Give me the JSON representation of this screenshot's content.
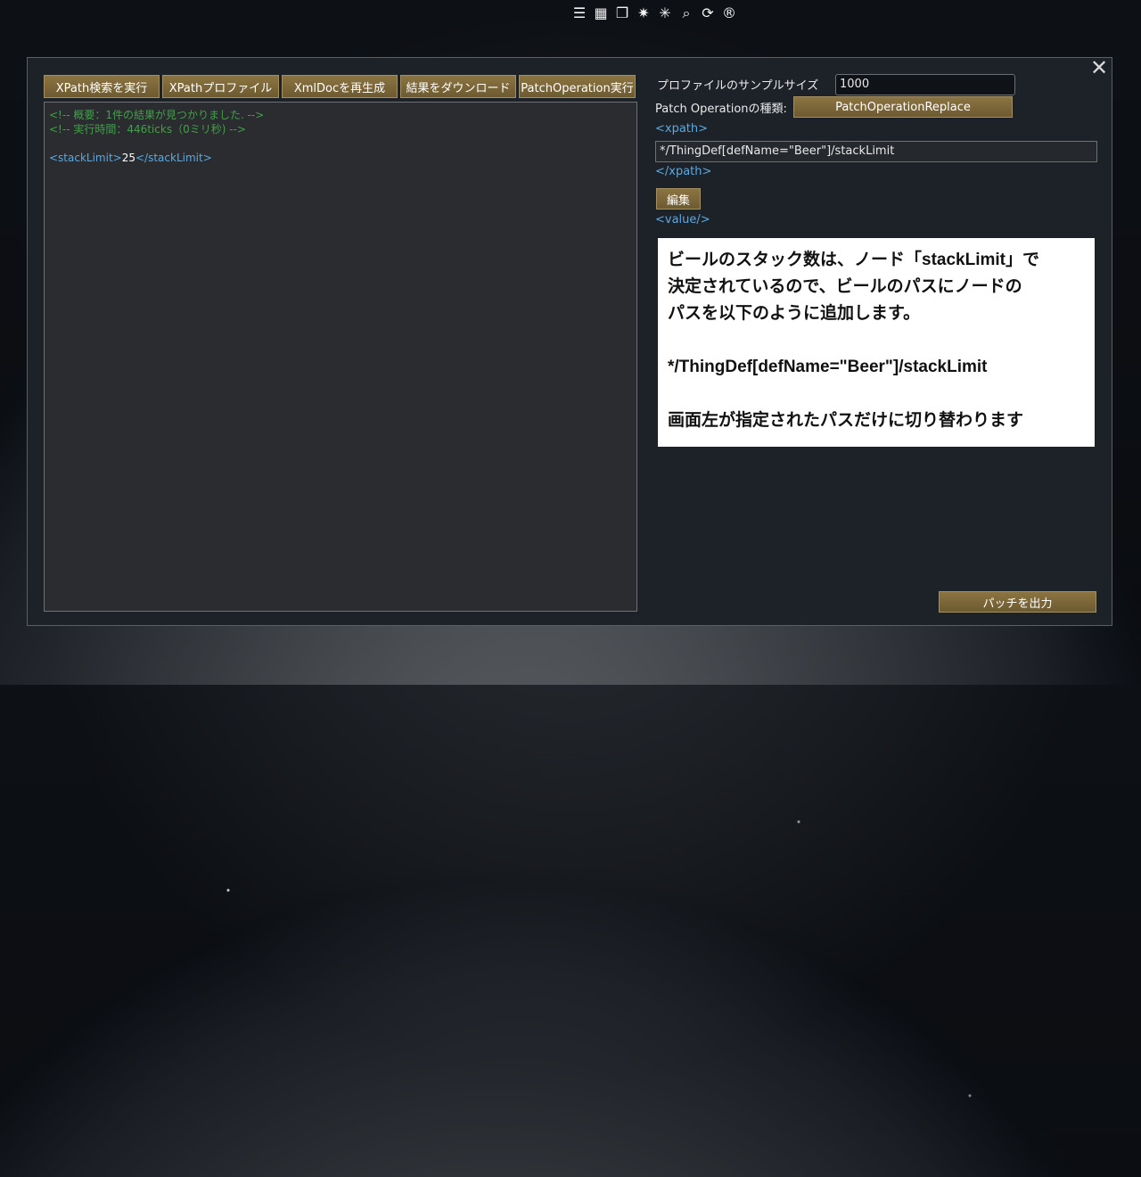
{
  "top_toolbar": {
    "icons": [
      {
        "name": "log-list-icon",
        "glyph": "☰"
      },
      {
        "name": "table-icon",
        "glyph": "▦"
      },
      {
        "name": "copy-stack-icon",
        "glyph": "❐"
      },
      {
        "name": "play-burst-icon",
        "glyph": "✷"
      },
      {
        "name": "burst-icon",
        "glyph": "✳"
      },
      {
        "name": "search-icon",
        "glyph": "⌕"
      },
      {
        "name": "refresh-icon",
        "glyph": "⟳"
      },
      {
        "name": "registered-reload-icon",
        "glyph": "®"
      }
    ]
  },
  "window": {
    "close_glyph": "✕",
    "buttons": {
      "run_xpath": "XPath検索を実行",
      "xpath_profile": "XPathプロファイル",
      "regen_xmldoc": "XmlDocを再生成",
      "download_result": "結果をダウンロード",
      "run_patch": "PatchOperation実行"
    },
    "result": {
      "summary_comment": "<!-- 概要：1件の結果が見つかりました. -->",
      "time_comment": "<!-- 実行時間：446ticks（0ミリ秒) -->",
      "open_tag": "<stackLimit>",
      "value": "25",
      "close_tag": "</stackLimit>"
    },
    "settings": {
      "sample_size_label": "プロファイルのサンプルサイズ",
      "sample_size_value": "1000",
      "patch_type_label": "Patch Operationの種類:",
      "patch_type_value": "PatchOperationReplace",
      "xpath_open": "<xpath>",
      "xpath_value": "*/ThingDef[defName=\"Beer\"]/stackLimit",
      "xpath_close": "</xpath>",
      "edit_button": "編集",
      "value_tag": "<value/>",
      "export_button": "パッチを出力"
    }
  },
  "note": {
    "line1": "ビールのスタック数は、ノード「stackLimit」で",
    "line2": "決定されているので、ビールのパスにノードの",
    "line3": "パスを以下のように追加します。",
    "line4": "",
    "line5": "*/ThingDef[defName=\"Beer\"]/stackLimit",
    "line6": "",
    "line7": "画面左が指定されたパスだけに切り替わります"
  },
  "colors": {
    "button_bg": "#7d6838",
    "comment": "#41a048",
    "tag": "#5aa9e2",
    "window_bg": "#1d2228"
  }
}
